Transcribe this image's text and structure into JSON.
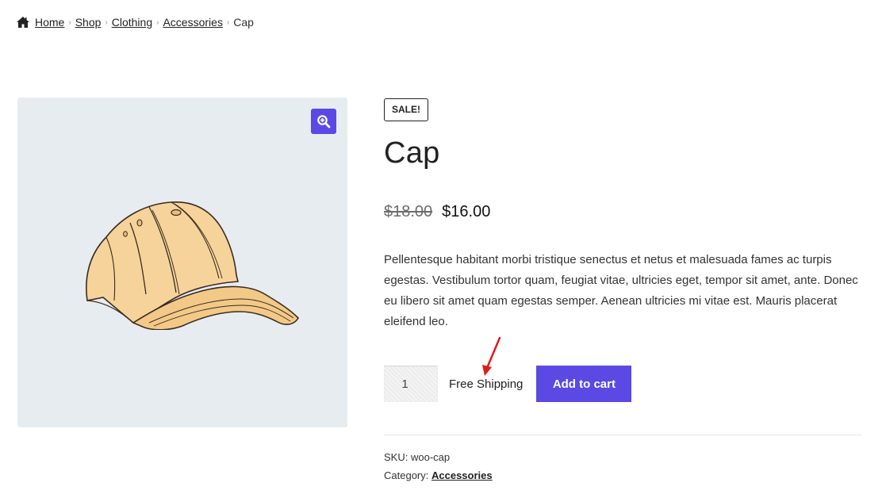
{
  "breadcrumb": {
    "home": "Home",
    "shop": "Shop",
    "clothing": "Clothing",
    "accessories": "Accessories",
    "current": "Cap",
    "separator": "›"
  },
  "gallery": {
    "zoom_icon": "magnify-plus-icon",
    "image_alt": "Cap"
  },
  "product": {
    "badge": "SALE!",
    "title": "Cap",
    "regular_price": "$18.00",
    "sale_price": "$16.00",
    "description": "Pellentesque habitant morbi tristique senectus et netus et malesuada fames ac turpis egestas. Vestibulum tortor quam, feugiat vitae, ultricies eget, tempor sit amet, ante. Donec eu libero sit amet quam egestas semper. Aenean ultricies mi vitae est. Mauris placerat eleifend leo.",
    "quantity": "1",
    "shipping_label": "Free Shipping",
    "add_to_cart": "Add to cart",
    "sku_label": "SKU:",
    "sku": "woo-cap",
    "category_label": "Category:",
    "category": "Accessories"
  },
  "colors": {
    "accent": "#5a4ae3",
    "annotation_arrow": "#e01b1b",
    "gallery_bg": "#e7ecf1"
  }
}
